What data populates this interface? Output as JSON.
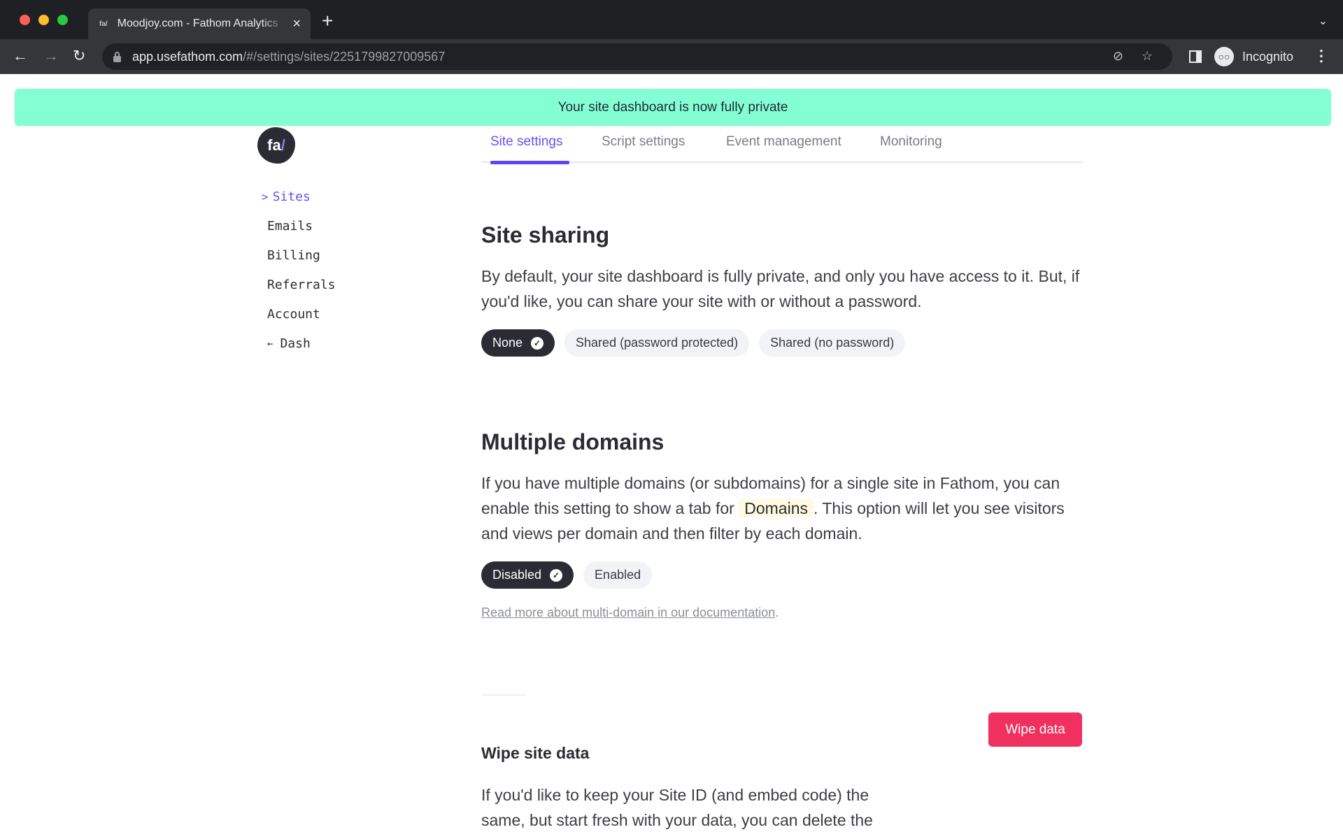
{
  "browser": {
    "tab_title": "Moodjoy.com - Fathom Analytics",
    "tab_favicon": "fa/",
    "new_tab_icon": "+",
    "tab_close_icon": "×",
    "url_host": "app.usefathom.com",
    "url_path": "/#/settings/sites/2251799827009567",
    "profile_label": "Incognito",
    "icons": {
      "back": "←",
      "forward": "→",
      "reload": "↻",
      "eye_off": "👁",
      "star": "☆",
      "menu": "⋮",
      "tab_list": "⌄"
    }
  },
  "banner": {
    "message": "Your site dashboard is now fully private",
    "color": "#84ffd3"
  },
  "logo": {
    "text": "fa",
    "slash": "/"
  },
  "sidebar": {
    "items": [
      {
        "label": "Sites",
        "active": true,
        "prefix": ">"
      },
      {
        "label": "Emails"
      },
      {
        "label": "Billing"
      },
      {
        "label": "Referrals"
      },
      {
        "label": "Account"
      },
      {
        "label": "Dash",
        "prefix": "←"
      }
    ]
  },
  "tabs": [
    {
      "label": "Site settings",
      "active": true
    },
    {
      "label": "Script settings"
    },
    {
      "label": "Event management"
    },
    {
      "label": "Monitoring"
    }
  ],
  "site_sharing": {
    "title": "Site sharing",
    "description": "By default, your site dashboard is fully private, and only you have access to it. But, if you'd like, you can share your site with or without a password.",
    "options": [
      {
        "label": "None",
        "selected": true
      },
      {
        "label": "Shared (password protected)"
      },
      {
        "label": "Shared (no password)"
      }
    ]
  },
  "multiple_domains": {
    "title": "Multiple domains",
    "description_before": "If you have multiple domains (or subdomains) for a single site in Fathom, you can enable this setting to show a tab for",
    "highlight": "Domains",
    "description_after": ". This option will let you see visitors and views per domain and then filter by each domain.",
    "options": [
      {
        "label": "Disabled",
        "selected": true
      },
      {
        "label": "Enabled"
      }
    ],
    "doc_link": "Read more about multi-domain in our documentation",
    "doc_link_suffix": "."
  },
  "wipe_site_data": {
    "title": "Wipe site data",
    "description": "If you'd like to keep your Site ID (and embed code) the same, but start fresh with your data, you can delete the",
    "button_label": "Wipe data",
    "button_color": "#f0305e"
  },
  "colors": {
    "accent": "#6a4ef7",
    "dark_pill": "#2b2b34"
  }
}
